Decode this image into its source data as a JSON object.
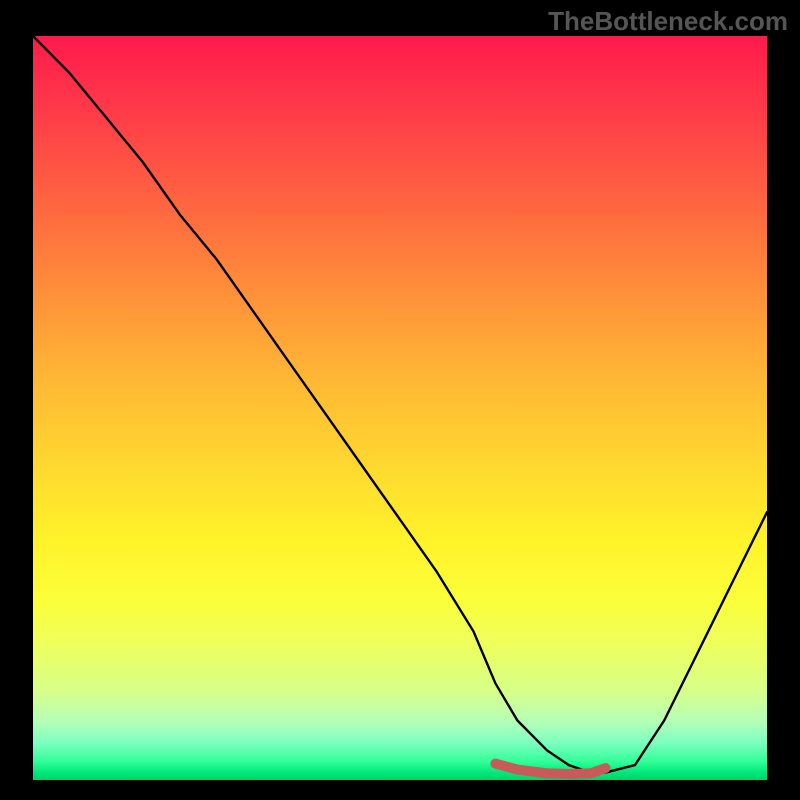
{
  "watermark": "TheBottleneck.com",
  "chart_data": {
    "type": "line",
    "title": "",
    "xlabel": "",
    "ylabel": "",
    "xlim": [
      0,
      100
    ],
    "ylim": [
      0,
      100
    ],
    "series": [
      {
        "name": "main-curve",
        "color": "#000000",
        "x": [
          0,
          5,
          10,
          15,
          20,
          25,
          30,
          35,
          40,
          45,
          50,
          55,
          60,
          63,
          66,
          70,
          73,
          76,
          78,
          82,
          86,
          90,
          94,
          98,
          100
        ],
        "values": [
          100,
          95,
          89,
          83,
          76,
          70,
          63,
          56,
          49,
          42,
          35,
          28,
          20,
          13,
          8,
          4,
          2,
          1,
          1,
          2,
          8,
          16,
          24,
          32,
          36
        ]
      },
      {
        "name": "optimal-zone",
        "color": "#c85a5a",
        "x": [
          63,
          66,
          70,
          73,
          76,
          78
        ],
        "values": [
          2.2,
          1.4,
          0.9,
          0.8,
          0.9,
          1.6
        ]
      }
    ],
    "gradient_stops": [
      {
        "pos": 0,
        "color": "#ff1a4b"
      },
      {
        "pos": 0.5,
        "color": "#ffc733"
      },
      {
        "pos": 0.8,
        "color": "#fbff3a"
      },
      {
        "pos": 1.0,
        "color": "#00d268"
      }
    ]
  }
}
